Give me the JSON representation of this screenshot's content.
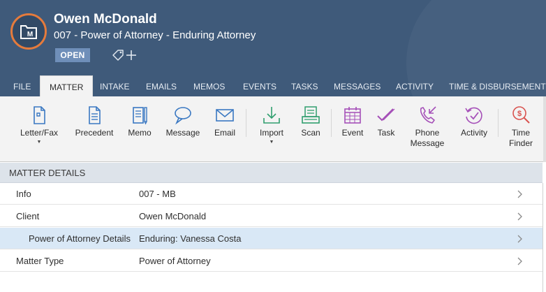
{
  "header": {
    "client_name": "Owen McDonald",
    "matter_title": "007 - Power of Attorney - Enduring Attorney",
    "status": "OPEN",
    "avatar_letter": "M",
    "colors": {
      "background": "#3f5a7a",
      "avatar_ring": "#e57b3c",
      "badge": "#6f8fb9"
    }
  },
  "tabs": [
    {
      "label": "FILE"
    },
    {
      "label": "MATTER",
      "active": true
    },
    {
      "label": "INTAKE"
    },
    {
      "label": "EMAILS"
    },
    {
      "label": "MEMOS"
    },
    {
      "label": "EVENTS"
    },
    {
      "label": "TASKS"
    },
    {
      "label": "MESSAGES"
    },
    {
      "label": "ACTIVITY"
    },
    {
      "label": "TIME & DISBURSEMENTS"
    }
  ],
  "ribbon": {
    "buttons": [
      {
        "line1": "Letter/Fax",
        "icon": "letter-icon",
        "caret": "▼"
      },
      {
        "line1": "Precedent",
        "icon": "precedent-icon"
      },
      {
        "line1": "Memo",
        "icon": "memo-icon"
      },
      {
        "line1": "Message",
        "icon": "message-icon"
      },
      {
        "line1": "Email",
        "icon": "email-icon"
      },
      {
        "line1": "Import",
        "icon": "import-icon",
        "caret": "▼"
      },
      {
        "line1": "Scan",
        "icon": "scan-icon"
      },
      {
        "line1": "Event",
        "icon": "event-icon"
      },
      {
        "line1": "Task",
        "icon": "task-icon"
      },
      {
        "line1": "Phone",
        "line2": "Message",
        "icon": "phone-message-icon"
      },
      {
        "line1": "Activity",
        "icon": "activity-icon"
      },
      {
        "line1": "Time",
        "line2": "Finder",
        "icon": "time-finder-icon"
      }
    ],
    "colors": {
      "blue": "#3a78c2",
      "green": "#2f9e6e",
      "purple": "#a54fb8",
      "red": "#d9534f"
    }
  },
  "details": {
    "heading": "MATTER DETAILS",
    "rows": [
      {
        "label": "Info",
        "value": "007 - MB"
      },
      {
        "label": "Client",
        "value": "Owen McDonald"
      },
      {
        "label": "Power of Attorney Details",
        "value": "Enduring: Vanessa Costa",
        "selected": true
      },
      {
        "label": "Matter Type",
        "value": "Power of Attorney"
      }
    ]
  }
}
